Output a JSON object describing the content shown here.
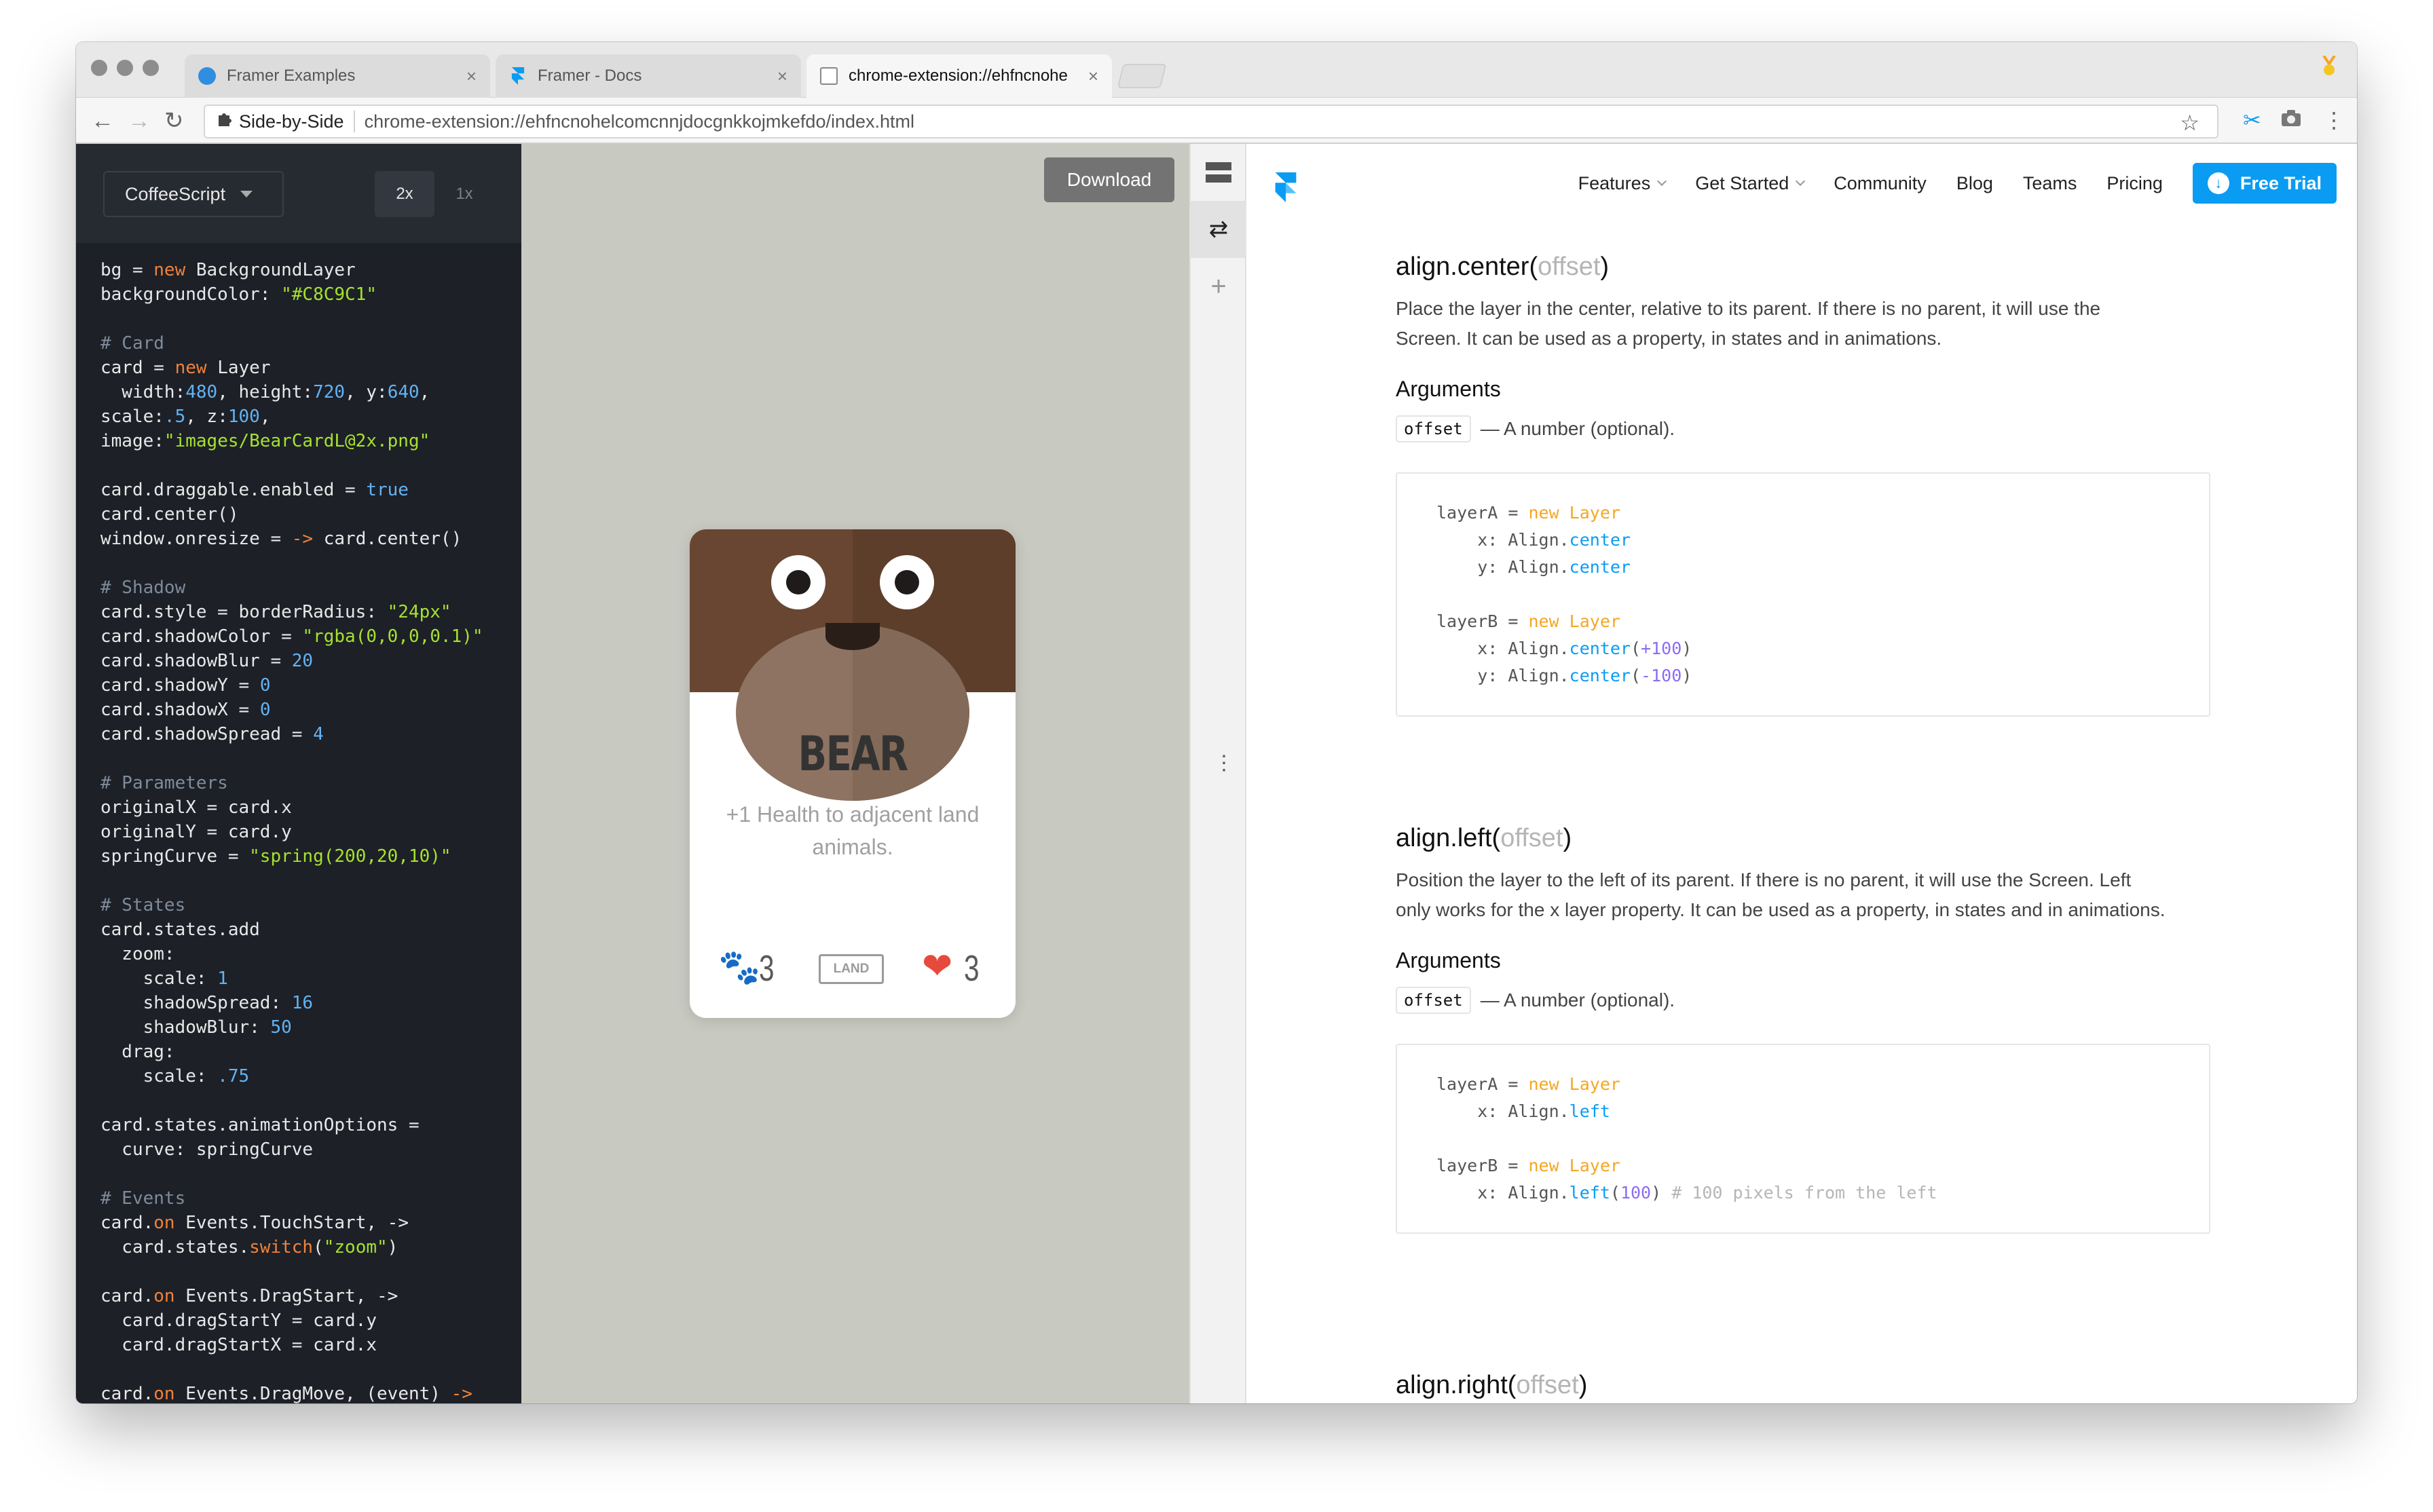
{
  "browser": {
    "tabs": [
      {
        "label": "Framer Examples",
        "icon": "framer-examples-favicon"
      },
      {
        "label": "Framer - Docs",
        "icon": "framer-favicon"
      },
      {
        "label": "chrome-extension://ehfncnohe",
        "icon": "page-favicon"
      }
    ],
    "close_glyph": "×",
    "url_chip": "Side-by-Side",
    "url": "chrome-extension://ehfncnohelcomcnnjdocgnkkojmkefdo/index.html",
    "back_glyph": "←",
    "forward_glyph": "→",
    "reload_glyph": "↻",
    "star_glyph": "☆",
    "menu_glyph": "⋮"
  },
  "editor": {
    "language": "CoffeeScript",
    "scale_2x": "2x",
    "scale_1x": "1x",
    "code_lines": [
      [
        [
          "bg = ",
          ""
        ],
        [
          "new",
          "k"
        ],
        [
          " BackgroundLayer",
          ""
        ]
      ],
      [
        [
          "backgroundColor: ",
          ""
        ],
        [
          "\"#C8C9C1\"",
          "s"
        ]
      ],
      [
        [
          "",
          ""
        ]
      ],
      [
        [
          "# Card",
          "c"
        ]
      ],
      [
        [
          "card = ",
          ""
        ],
        [
          "new",
          "k"
        ],
        [
          " Layer",
          ""
        ]
      ],
      [
        [
          "  width:",
          ""
        ],
        [
          "480",
          "n"
        ],
        [
          ", height:",
          ""
        ],
        [
          "720",
          "n"
        ],
        [
          ", y:",
          ""
        ],
        [
          "640",
          "n"
        ],
        [
          ",",
          ""
        ]
      ],
      [
        [
          "scale:",
          ""
        ],
        [
          ".5",
          "n"
        ],
        [
          ", z:",
          ""
        ],
        [
          "100",
          "n"
        ],
        [
          ",",
          ""
        ]
      ],
      [
        [
          "image:",
          ""
        ],
        [
          "\"images/BearCardL@2x.png\"",
          "s"
        ]
      ],
      [
        [
          "",
          ""
        ]
      ],
      [
        [
          "card.draggable.enabled = ",
          ""
        ],
        [
          "true",
          "n"
        ]
      ],
      [
        [
          "card.center()",
          ""
        ]
      ],
      [
        [
          "window.onresize = ",
          ""
        ],
        [
          "->",
          "k"
        ],
        [
          " card.center()",
          ""
        ]
      ],
      [
        [
          "",
          ""
        ]
      ],
      [
        [
          "# Shadow",
          "c"
        ]
      ],
      [
        [
          "card.style = borderRadius: ",
          ""
        ],
        [
          "\"24px\"",
          "s"
        ]
      ],
      [
        [
          "card.shadowColor = ",
          ""
        ],
        [
          "\"rgba(0,0,0,0.1)\"",
          "s"
        ]
      ],
      [
        [
          "card.shadowBlur = ",
          ""
        ],
        [
          "20",
          "n"
        ]
      ],
      [
        [
          "card.shadowY = ",
          ""
        ],
        [
          "0",
          "n"
        ]
      ],
      [
        [
          "card.shadowX = ",
          ""
        ],
        [
          "0",
          "n"
        ]
      ],
      [
        [
          "card.shadowSpread = ",
          ""
        ],
        [
          "4",
          "n"
        ]
      ],
      [
        [
          "",
          ""
        ]
      ],
      [
        [
          "# Parameters",
          "c"
        ]
      ],
      [
        [
          "originalX = card.x",
          ""
        ]
      ],
      [
        [
          "originalY = card.y",
          ""
        ]
      ],
      [
        [
          "springCurve = ",
          ""
        ],
        [
          "\"spring(200,20,10)\"",
          "s"
        ]
      ],
      [
        [
          "",
          ""
        ]
      ],
      [
        [
          "# States",
          "c"
        ]
      ],
      [
        [
          "card.states.add",
          ""
        ]
      ],
      [
        [
          "  zoom:",
          ""
        ]
      ],
      [
        [
          "    scale: ",
          ""
        ],
        [
          "1",
          "n"
        ]
      ],
      [
        [
          "    shadowSpread: ",
          ""
        ],
        [
          "16",
          "n"
        ]
      ],
      [
        [
          "    shadowBlur: ",
          ""
        ],
        [
          "50",
          "n"
        ]
      ],
      [
        [
          "  drag:",
          ""
        ]
      ],
      [
        [
          "    scale: ",
          ""
        ],
        [
          ".75",
          "n"
        ]
      ],
      [
        [
          "",
          ""
        ]
      ],
      [
        [
          "card.states.animationOptions =",
          ""
        ]
      ],
      [
        [
          "  curve: springCurve",
          ""
        ]
      ],
      [
        [
          "",
          ""
        ]
      ],
      [
        [
          "# Events",
          "c"
        ]
      ],
      [
        [
          "card.",
          ""
        ],
        [
          "on",
          "k"
        ],
        [
          " Events.TouchStart, ->",
          ""
        ]
      ],
      [
        [
          "  card.states.",
          ""
        ],
        [
          "switch",
          "k"
        ],
        [
          "(",
          ""
        ],
        [
          "\"zoom\"",
          "s"
        ],
        [
          ")",
          ""
        ]
      ],
      [
        [
          "",
          ""
        ]
      ],
      [
        [
          "card.",
          ""
        ],
        [
          "on",
          "k"
        ],
        [
          " Events.DragStart, ->",
          ""
        ]
      ],
      [
        [
          "  card.dragStartY = card.y",
          ""
        ]
      ],
      [
        [
          "  card.dragStartX = card.x",
          ""
        ]
      ],
      [
        [
          "",
          ""
        ]
      ],
      [
        [
          "card.",
          ""
        ],
        [
          "on",
          "k"
        ],
        [
          " Events.DragMove, (event) ",
          ""
        ],
        [
          "->",
          "k"
        ]
      ]
    ]
  },
  "preview": {
    "download_label": "Download",
    "card": {
      "title": "BEAR",
      "description": "+1 Health to adjacent land animals.",
      "attack_value": "3",
      "type_label": "LAND",
      "health_value": "3",
      "paw_glyph": "🐾",
      "heart_glyph": "❤"
    }
  },
  "splitbar": {
    "stack_glyph": "☰",
    "swap_glyph": "⇄",
    "plus_glyph": "+",
    "more_glyph": "⋮"
  },
  "docs": {
    "nav": [
      {
        "label": "Features",
        "dropdown": true
      },
      {
        "label": "Get Started",
        "dropdown": true
      },
      {
        "label": "Community",
        "dropdown": false
      },
      {
        "label": "Blog",
        "dropdown": false
      },
      {
        "label": "Teams",
        "dropdown": false
      },
      {
        "label": "Pricing",
        "dropdown": false
      }
    ],
    "trial_label": "Free Trial",
    "trial_icon": "↓",
    "sections": [
      {
        "name": "align.center",
        "paren_open": "(",
        "arg": "offset",
        "paren_close": ")",
        "desc": "Place the layer in the center, relative to its parent. If there is no parent, it will use the Screen. It can be used as a property, in states and in animations.",
        "args_heading": "Arguments",
        "arg_code": "offset",
        "arg_desc": "— A number (optional).",
        "code_lines": [
          [
            [
              "layerA = ",
              ""
            ],
            [
              "new Layer",
              "k"
            ]
          ],
          [
            [
              "    x: Align.",
              ""
            ],
            [
              "center",
              "b"
            ]
          ],
          [
            [
              "    y: Align.",
              ""
            ],
            [
              "center",
              "b"
            ]
          ],
          [
            [
              "",
              ""
            ]
          ],
          [
            [
              "layerB = ",
              ""
            ],
            [
              "new Layer",
              "k"
            ]
          ],
          [
            [
              "    x: Align.",
              ""
            ],
            [
              "center",
              "b"
            ],
            [
              "(",
              ""
            ],
            [
              "+100",
              "pu"
            ],
            [
              ")",
              ""
            ]
          ],
          [
            [
              "    y: Align.",
              ""
            ],
            [
              "center",
              "b"
            ],
            [
              "(",
              ""
            ],
            [
              "-100",
              "pu"
            ],
            [
              ")",
              ""
            ]
          ]
        ]
      },
      {
        "name": "align.left",
        "paren_open": "(",
        "arg": "offset",
        "paren_close": ")",
        "desc": "Position the layer to the left of its parent. If there is no parent, it will use the Screen. Left only works for the x layer property. It can be used as a property, in states and in animations.",
        "args_heading": "Arguments",
        "arg_code": "offset",
        "arg_desc": "— A number (optional).",
        "code_lines": [
          [
            [
              "layerA = ",
              ""
            ],
            [
              "new Layer",
              "k"
            ]
          ],
          [
            [
              "    x: Align.",
              ""
            ],
            [
              "left",
              "b"
            ]
          ],
          [
            [
              "",
              ""
            ]
          ],
          [
            [
              "layerB = ",
              ""
            ],
            [
              "new Layer",
              "k"
            ]
          ],
          [
            [
              "    x: Align.",
              ""
            ],
            [
              "left",
              "b"
            ],
            [
              "(",
              ""
            ],
            [
              "100",
              "pu"
            ],
            [
              ") ",
              ""
            ],
            [
              "# 100 pixels from the left",
              "cm"
            ]
          ]
        ]
      }
    ],
    "next_heading": {
      "name": "align.right",
      "paren_open": "(",
      "arg": "offset",
      "paren_close": ")"
    }
  },
  "colors": {
    "editor_bg": "#1d2027",
    "preview_bg": "#c8c9c1",
    "accent": "#0a9cf2",
    "keyword": "#f5a623"
  }
}
